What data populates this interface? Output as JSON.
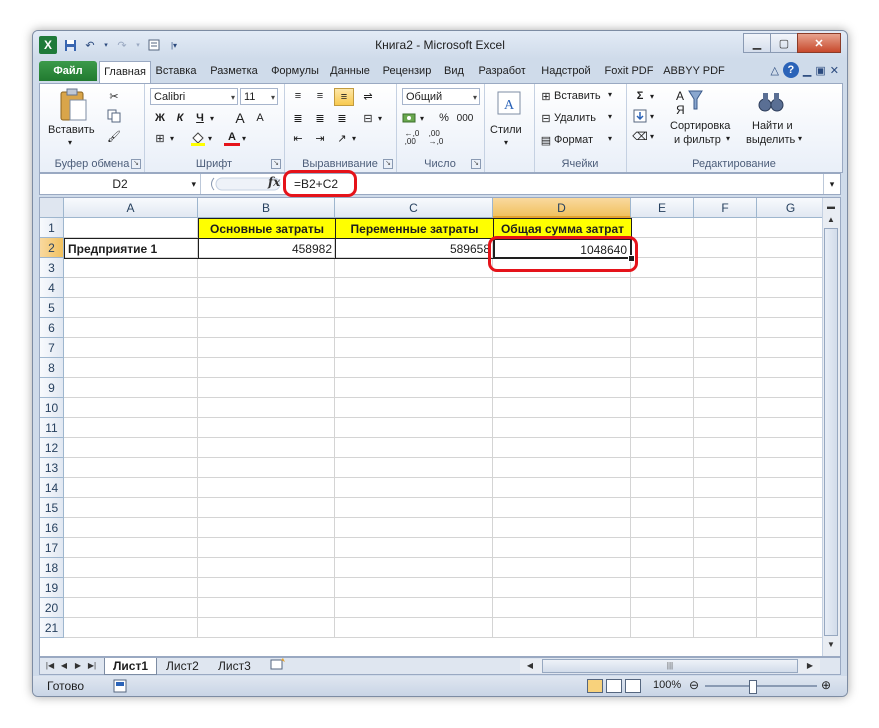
{
  "window": {
    "title": "Книга2 - Microsoft Excel"
  },
  "tabs": [
    {
      "label": "Файл"
    },
    {
      "label": "Главная"
    },
    {
      "label": "Вставка"
    },
    {
      "label": "Разметка"
    },
    {
      "label": "Формулы"
    },
    {
      "label": "Данные"
    },
    {
      "label": "Рецензир"
    },
    {
      "label": "Вид"
    },
    {
      "label": "Разрабоτ"
    },
    {
      "label": "Надстрой"
    },
    {
      "label": "Foxit PDF"
    },
    {
      "label": "ABBYY PDF"
    }
  ],
  "ribbon": {
    "clipboard": {
      "paste": "Вставить",
      "group": "Буфер обмена"
    },
    "font": {
      "name": "Calibri",
      "size": "11",
      "bold": "Ж",
      "italic": "К",
      "underline": "Ч",
      "group": "Шрифт"
    },
    "alignment": {
      "group": "Выравнивание"
    },
    "number": {
      "format": "Общий",
      "percent": "%",
      "thousands": "000",
      "group": "Число"
    },
    "styles": {
      "label": "Стили"
    },
    "cells": {
      "insert": "Вставить",
      "delete": "Удалить",
      "format": "Формат",
      "group": "Ячейки"
    },
    "editing": {
      "sum": "Σ",
      "sort_line1": "Сортировка",
      "sort_line2": "и фильтр",
      "find_line1": "Найти и",
      "find_line2": "выделить",
      "group": "Редактирование"
    }
  },
  "formula_bar": {
    "name_box": "D2",
    "fx": "fx",
    "formula": "=B2+C2"
  },
  "columns": [
    "A",
    "B",
    "C",
    "D",
    "E",
    "F",
    "G"
  ],
  "rows": [
    "1",
    "2",
    "3",
    "4",
    "5",
    "6",
    "7",
    "8",
    "9",
    "10",
    "11",
    "12",
    "13",
    "14",
    "15",
    "16",
    "17",
    "18",
    "19",
    "20",
    "21"
  ],
  "cells": {
    "B1": "Основные затраты",
    "C1": "Переменные затраты",
    "D1": "Общая сумма затрат",
    "A2": "Предприятие 1",
    "B2": "458982",
    "C2": "589658",
    "D2": "1048640"
  },
  "sheets": [
    "Лист1",
    "Лист2",
    "Лист3"
  ],
  "status": {
    "ready": "Готово",
    "zoom": "100%"
  },
  "colors": {
    "header_fill": "#ffff00",
    "highlight_circle": "#e5131a",
    "file_tab": "#217a30"
  }
}
